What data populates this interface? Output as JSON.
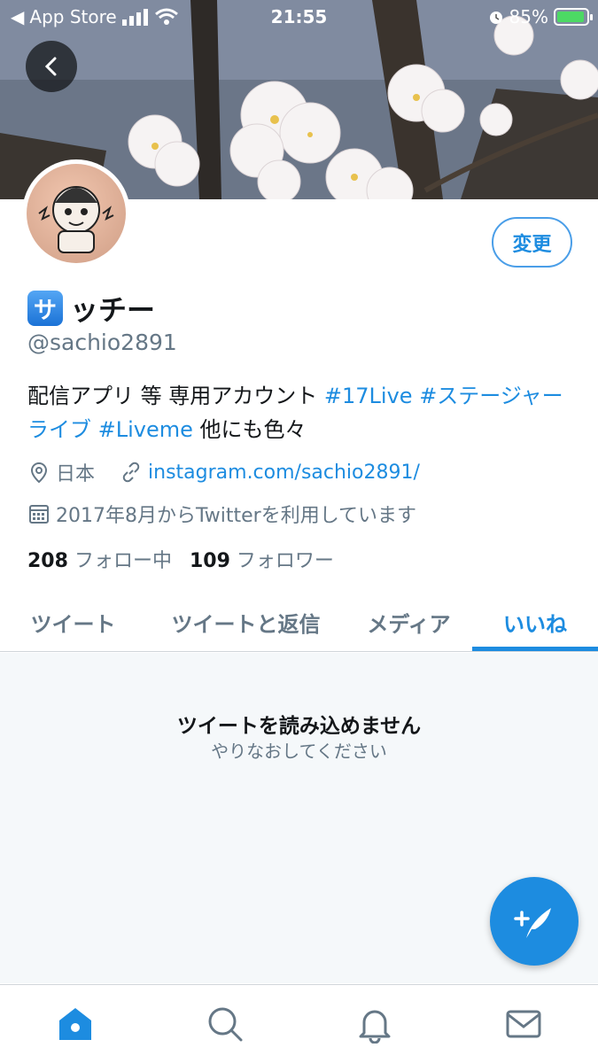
{
  "status_bar": {
    "back_app": "App Store",
    "time": "21:55",
    "battery": "85%"
  },
  "profile": {
    "badge_char": "サ",
    "name": "ッチー",
    "handle": "@sachio2891",
    "edit_label": "変更",
    "bio_text": "配信アプリ 等 専用アカウント ",
    "bio_tag1": "#17Live",
    "bio_tag2": "#ステージャーライブ",
    "bio_tag3": "#Liveme",
    "bio_tail": " 他にも色々",
    "location": "日本",
    "website": "instagram.com/sachio2891/",
    "joined": "2017年8月からTwitterを利用しています",
    "following_count": "208",
    "following_label": "フォロー中",
    "followers_count": "109",
    "followers_label": "フォロワー"
  },
  "tabs": [
    {
      "label": "ツイート",
      "active": false
    },
    {
      "label": "ツイートと返信",
      "active": false
    },
    {
      "label": "メディア",
      "active": false
    },
    {
      "label": "いいね",
      "active": true
    }
  ],
  "content": {
    "error_title": "ツイートを読み込めません",
    "error_sub": "やりなおしてください"
  },
  "bottom_nav": {
    "items": [
      "home-icon",
      "search-icon",
      "notifications-icon",
      "messages-icon"
    ],
    "active": "home-icon"
  },
  "colors": {
    "accent": "#1d8ce0",
    "secondary_text": "#657786",
    "background_empty": "#f5f8fa"
  }
}
